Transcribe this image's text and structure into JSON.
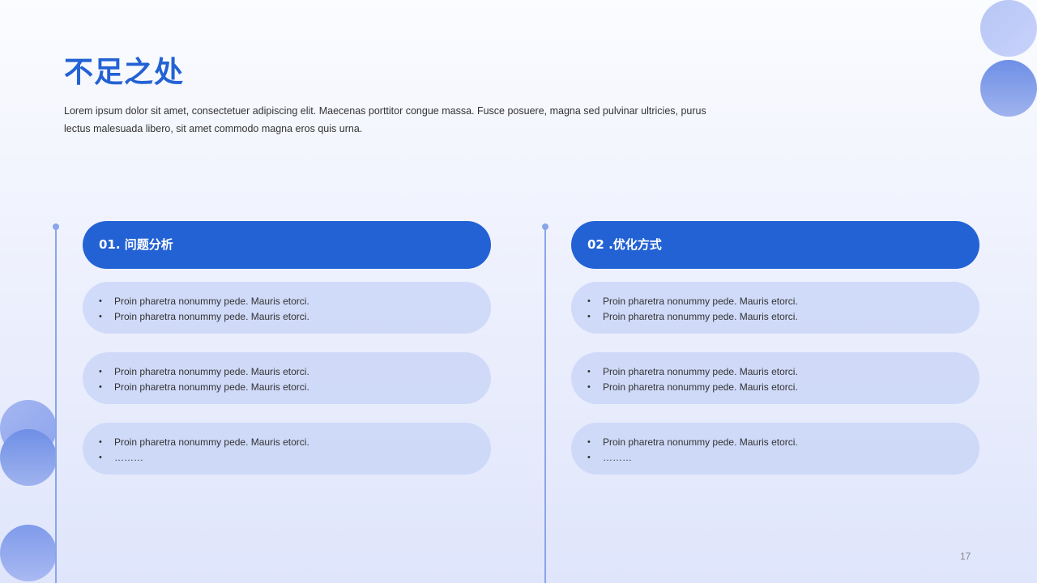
{
  "slide": {
    "title": "不足之处",
    "intro": "Lorem ipsum dolor sit amet, consectetuer adipiscing elit. Maecenas porttitor congue massa. Fusce posuere, magna sed pulvinar ultricies, purus lectus malesuada libero, sit amet commodo magna eros quis urna.",
    "page_number": "17"
  },
  "columns": [
    {
      "header": "01. 问题分析",
      "groups": [
        [
          "Proin pharetra nonummy pede. Mauris etorci.",
          "Proin pharetra nonummy pede. Mauris etorci."
        ],
        [
          "Proin pharetra nonummy pede. Mauris etorci.",
          "Proin pharetra nonummy pede. Mauris etorci."
        ],
        [
          "Proin pharetra nonummy pede. Mauris etorci.",
          "………"
        ]
      ]
    },
    {
      "header": "02 .优化方式",
      "groups": [
        [
          "Proin pharetra nonummy pede. Mauris etorci.",
          "Proin pharetra nonummy pede. Mauris etorci."
        ],
        [
          "Proin pharetra nonummy pede. Mauris etorci.",
          "Proin pharetra nonummy pede. Mauris etorci."
        ],
        [
          "Proin pharetra nonummy pede. Mauris etorci.",
          "………"
        ]
      ]
    }
  ],
  "colors": {
    "accent": "#2362d4",
    "pill_light": "#d3ddf8",
    "line": "#8aa5ea"
  }
}
